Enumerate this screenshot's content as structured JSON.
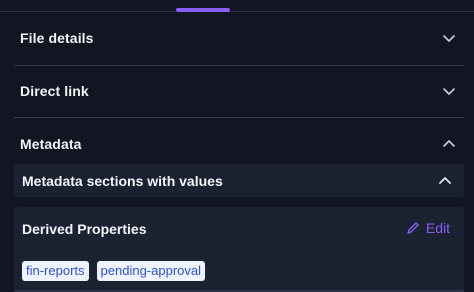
{
  "theme": {
    "accent": "#8b5cf6",
    "chip_text": "#2f52d0",
    "chip_background": "#eef3ff"
  },
  "sections": [
    {
      "label": "File details",
      "state": "collapsed",
      "icon": "chevron-down-icon"
    },
    {
      "label": "Direct link",
      "state": "collapsed",
      "icon": "chevron-down-icon"
    },
    {
      "label": "Metadata",
      "state": "expanded",
      "icon": "chevron-up-icon"
    }
  ],
  "metadata": {
    "subsection": {
      "label": "Metadata sections with values",
      "state": "expanded",
      "icon": "chevron-up-icon"
    },
    "card": {
      "title": "Derived Properties",
      "edit_label": "Edit",
      "edit_icon": "pencil-icon",
      "tags": [
        "fin-reports",
        "pending-approval"
      ]
    }
  }
}
